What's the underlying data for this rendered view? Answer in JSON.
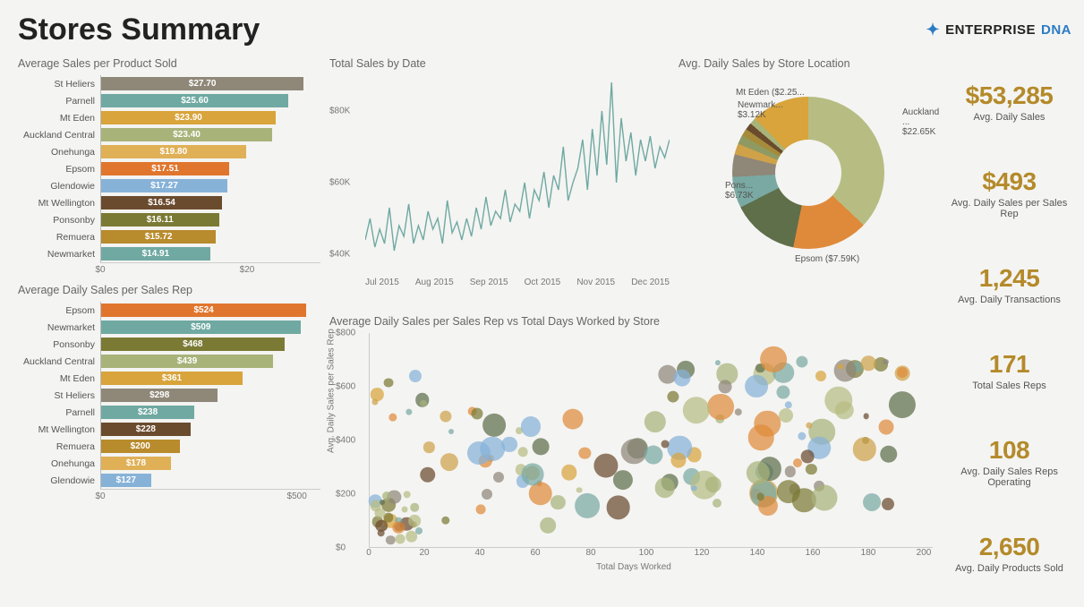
{
  "header": {
    "title": "Stores Summary",
    "brand_a": "ENTERPRISE",
    "brand_b": "DNA"
  },
  "kpi": [
    {
      "value": "$53,285",
      "label": "Avg. Daily Sales"
    },
    {
      "value": "$493",
      "label": "Avg. Daily Sales per Sales Rep"
    },
    {
      "value": "1,245",
      "label": "Avg. Daily Transactions"
    },
    {
      "value": "171",
      "label": "Total Sales Reps"
    },
    {
      "value": "108",
      "label": "Avg. Daily Sales Reps Operating"
    },
    {
      "value": "2,650",
      "label": "Avg. Daily Products Sold"
    }
  ],
  "chart_data": [
    {
      "id": "avg_sales_per_product",
      "type": "bar",
      "title": "Average Sales per Product Sold",
      "xlim": [
        0,
        30
      ],
      "xticks": [
        0,
        20
      ],
      "categories": [
        "St Heliers",
        "Parnell",
        "Mt Eden",
        "Auckland Central",
        "Onehunga",
        "Epsom",
        "Glendowie",
        "Mt Wellington",
        "Ponsonby",
        "Remuera",
        "Newmarket"
      ],
      "values": [
        27.7,
        25.6,
        23.9,
        23.4,
        19.8,
        17.51,
        17.27,
        16.54,
        16.11,
        15.72,
        14.91
      ],
      "value_labels": [
        "$27.70",
        "$25.60",
        "$23.90",
        "$23.40",
        "$19.80",
        "$17.51",
        "$17.27",
        "$16.54",
        "$16.11",
        "$15.72",
        "$14.91"
      ],
      "colors": [
        "#8f8778",
        "#6fa9a2",
        "#d8a43b",
        "#a8b37a",
        "#e0b057",
        "#e0762d",
        "#87b2d8",
        "#6b4b2e",
        "#7b7a35",
        "#b88b2c",
        "#6fa9a2"
      ]
    },
    {
      "id": "avg_daily_sales_per_rep",
      "type": "bar",
      "title": "Average Daily Sales per Sales Rep",
      "xlim": [
        0,
        560
      ],
      "xticks": [
        0,
        500
      ],
      "categories": [
        "Epsom",
        "Newmarket",
        "Ponsonby",
        "Auckland Central",
        "Mt Eden",
        "St Heliers",
        "Parnell",
        "Mt Wellington",
        "Remuera",
        "Onehunga",
        "Glendowie"
      ],
      "values": [
        524,
        509,
        468,
        439,
        361,
        298,
        238,
        228,
        200,
        178,
        127
      ],
      "value_labels": [
        "$524",
        "$509",
        "$468",
        "$439",
        "$361",
        "$298",
        "$238",
        "$228",
        "$200",
        "$178",
        "$127"
      ],
      "colors": [
        "#e0762d",
        "#6fa9a2",
        "#7b7a35",
        "#a8b37a",
        "#d8a43b",
        "#8f8778",
        "#6fa9a2",
        "#6b4b2e",
        "#b88b2c",
        "#e0b057",
        "#87b2d8"
      ]
    },
    {
      "id": "total_sales_by_date",
      "type": "line",
      "title": "Total Sales by Date",
      "ylabel": "",
      "xlabel": "",
      "ylim": [
        35000,
        90000
      ],
      "yticks": [
        40000,
        60000,
        80000
      ],
      "ytick_labels": [
        "$40K",
        "$60K",
        "$80K"
      ],
      "x_labels": [
        "Jul 2015",
        "Aug 2015",
        "Sep 2015",
        "Oct 2015",
        "Nov 2015",
        "Dec 2015"
      ],
      "series": [
        {
          "name": "Total Sales",
          "color": "#6fa9a2",
          "y": [
            44000,
            50000,
            42000,
            47000,
            43000,
            53000,
            41000,
            48000,
            45000,
            54000,
            43000,
            48000,
            44000,
            52000,
            47000,
            50000,
            43000,
            55000,
            46000,
            49000,
            44000,
            50000,
            45000,
            53000,
            47000,
            56000,
            48000,
            52000,
            50000,
            58000,
            49000,
            54000,
            52000,
            60000,
            50000,
            58000,
            55000,
            63000,
            53000,
            62000,
            58000,
            70000,
            55000,
            60000,
            64000,
            72000,
            58000,
            75000,
            62000,
            80000,
            65000,
            88000,
            60000,
            78000,
            66000,
            74000,
            62000,
            72000,
            66000,
            73000,
            64000,
            70000,
            67000,
            72000
          ]
        }
      ]
    },
    {
      "id": "avg_daily_sales_by_location",
      "type": "pie",
      "title": "Avg. Daily Sales by Store Location",
      "series": [
        {
          "name": "Auckland ...",
          "value": 22650,
          "label": "Auckland ...\n$22.65K",
          "color": "#b7bd82"
        },
        {
          "name": "Epsom",
          "value": 7590,
          "label": "Epsom ($7.59K)",
          "color": "#df8a3a"
        },
        {
          "name": "Ponsonby",
          "value": 6730,
          "label": "Pons...\n$6.73K",
          "color": "#5e6f4a"
        },
        {
          "name": "Newmarket",
          "value": 3120,
          "label": "Newmark...\n$3.12K",
          "color": "#79a9a2"
        },
        {
          "name": "Mt Eden",
          "value": 2250,
          "label": "Mt Eden ($2.25...",
          "color": "#8f8778"
        },
        {
          "name": "Other1",
          "value": 1100,
          "label": "",
          "color": "#cfa24a"
        },
        {
          "name": "Other2",
          "value": 900,
          "label": "",
          "color": "#8f9a62"
        },
        {
          "name": "Other3",
          "value": 750,
          "label": "",
          "color": "#a58b3a"
        },
        {
          "name": "Other4",
          "value": 700,
          "label": "",
          "color": "#6b4b2e"
        },
        {
          "name": "Other5",
          "value": 650,
          "label": "",
          "color": "#a8b37a"
        },
        {
          "name": "Other6",
          "value": 600,
          "label": "",
          "color": "#d8a43b"
        }
      ]
    },
    {
      "id": "scatter_rep_vs_days",
      "type": "scatter",
      "title": "Average Daily Sales per Sales Rep vs Total Days Worked by Store",
      "xlabel": "Total Days Worked",
      "ylabel": "Avg. Daily Sales per Sales Rep",
      "xlim": [
        0,
        200
      ],
      "ylim": [
        0,
        800
      ],
      "xticks": [
        0,
        20,
        40,
        60,
        80,
        100,
        120,
        140,
        160,
        180,
        200
      ],
      "yticks": [
        0,
        200,
        400,
        600,
        800
      ],
      "ytick_labels": [
        "$0",
        "$200",
        "$400",
        "$600",
        "$800"
      ]
    }
  ]
}
